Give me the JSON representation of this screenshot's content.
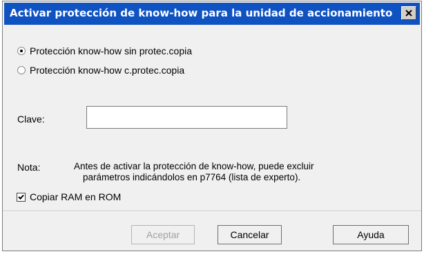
{
  "window": {
    "title": "Activar protección de know-how para la unidad de accionamiento",
    "title_bar_color": "#0f52c2"
  },
  "protection_options": [
    {
      "label": "Protección know-how sin protec.copia",
      "selected": true
    },
    {
      "label": "Protección know-how c.protec.copia",
      "selected": false
    }
  ],
  "password": {
    "label": "Clave:",
    "value": ""
  },
  "note": {
    "label": "Nota:",
    "line1": "Antes de activar la protección de know-how, puede excluir",
    "line2": "parámetros indicándolos en p7764 (lista de experto)."
  },
  "copy_ram": {
    "label": "Copiar RAM en ROM",
    "checked": true
  },
  "buttons": {
    "accept": "Aceptar",
    "cancel": "Cancelar",
    "help": "Ayuda"
  },
  "icons": {
    "close": "close-icon",
    "checkmark": "checkmark-icon"
  }
}
